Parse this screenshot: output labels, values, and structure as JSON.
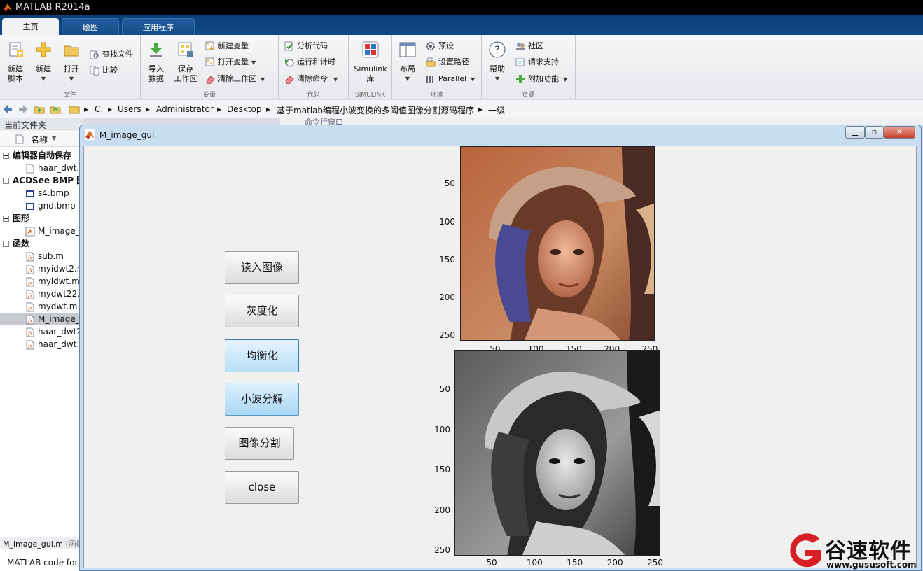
{
  "app": {
    "title": "MATLAB R2014a"
  },
  "ribbon_tabs": [
    {
      "label": "主页",
      "active": true
    },
    {
      "label": "绘图",
      "active": false
    },
    {
      "label": "应用程序",
      "active": false
    }
  ],
  "ribbon": {
    "file": {
      "label": "文件",
      "new_script": "新建\n脚本",
      "new": "新建",
      "open": "打开",
      "find_files": "查找文件",
      "compare": "比较"
    },
    "variable": {
      "label": "变量",
      "import": "导入\n数据",
      "save_ws": "保存\n工作区",
      "new_var": "新建变量",
      "open_var": "打开变量",
      "clear_ws": "清除工作区"
    },
    "code": {
      "label": "代码",
      "analyze": "分析代码",
      "run_time": "运行和计时",
      "clear_cmd": "清除命令"
    },
    "simulink": {
      "label": "SIMULINK",
      "lib": "Simulink\n库"
    },
    "env": {
      "label": "环境",
      "layout": "布局",
      "prefs": "预设",
      "set_path": "设置路径",
      "parallel": "Parallel"
    },
    "resources": {
      "label": "资源",
      "help": "帮助",
      "community": "社区",
      "support": "请求支持",
      "addons": "附加功能"
    }
  },
  "address": {
    "segments": [
      "C:",
      "Users",
      "Administrator",
      "Desktop",
      "基于matlab编程小波变换的多阈值图像分割源码程序",
      "一级"
    ]
  },
  "left_panel": {
    "title": "当前文件夹",
    "col_name": "名称",
    "rows": [
      {
        "text": "编辑器自动保存",
        "kind": "section"
      },
      {
        "text": "haar_dwt.",
        "kind": "file-m"
      },
      {
        "text": "ACDSee BMP 图",
        "kind": "section"
      },
      {
        "text": "s4.bmp",
        "kind": "file-bmp"
      },
      {
        "text": "gnd.bmp",
        "kind": "file-bmp"
      },
      {
        "text": "图形",
        "kind": "section"
      },
      {
        "text": "M_image_",
        "kind": "file-fig"
      },
      {
        "text": "函数",
        "kind": "section"
      },
      {
        "text": "sub.m",
        "kind": "file-fx"
      },
      {
        "text": "myidwt2.n",
        "kind": "file-fx"
      },
      {
        "text": "myidwt.m",
        "kind": "file-fx"
      },
      {
        "text": "mydwt22.",
        "kind": "file-fx"
      },
      {
        "text": "mydwt.m",
        "kind": "file-fx"
      },
      {
        "text": "M_image_",
        "kind": "file-fx",
        "selected": true
      },
      {
        "text": "haar_dwt2",
        "kind": "file-fx"
      },
      {
        "text": "haar_dwt.",
        "kind": "file-fx"
      }
    ],
    "details_file": "M_image_gui.m",
    "details_type": "(函数",
    "details_desc": "MATLAB code for"
  },
  "behind": {
    "cmd_title": "命令行窗口"
  },
  "figure": {
    "title": "M_image_gui",
    "buttons": {
      "read": "读入图像",
      "gray": "灰度化",
      "equalize": "均衡化",
      "wavelet": "小波分解",
      "segment": "图像分割",
      "close": "close"
    },
    "axes1": {
      "yticks": [
        "50",
        "100",
        "150",
        "200",
        "250"
      ],
      "xticks": [
        "50",
        "100",
        "150",
        "200",
        "250"
      ]
    },
    "axes2": {
      "yticks": [
        "50",
        "100",
        "150",
        "200",
        "250"
      ],
      "xticks": [
        "50",
        "100",
        "150",
        "200",
        "250"
      ]
    }
  },
  "watermark": {
    "brand": "谷速软件",
    "url": "www.gususoft.com"
  }
}
